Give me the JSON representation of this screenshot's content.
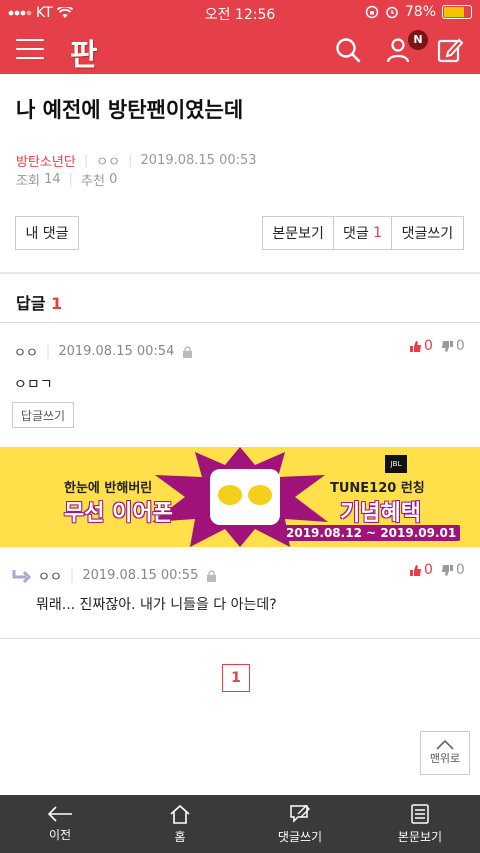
{
  "status_bar": {
    "carrier": "KT",
    "time": "오전 12:56",
    "battery": "78%",
    "battery_level": 0.78
  },
  "header": {
    "logo": "판",
    "notification_badge": "N"
  },
  "post": {
    "title": "나 예전에 방탄팬이였는데",
    "category": "방탄소년단",
    "author": "ㅇㅇ",
    "date": "2019.08.15 00:53",
    "views_label": "조회",
    "views": "14",
    "recommend_label": "추천",
    "recommend": "0"
  },
  "actions": {
    "my_comments": "내 댓글",
    "view_post": "본문보기",
    "comments_label": "댓글",
    "comments_count": "1",
    "write_comment": "댓글쓰기"
  },
  "replies": {
    "heading": "답글",
    "count": "1"
  },
  "comments": [
    {
      "author": "ㅇㅇ",
      "date": "2019.08.15 00:54",
      "likes": "0",
      "dislikes": "0",
      "text": "ㅇㅁㄱ",
      "reply_button": "답글쓰기"
    },
    {
      "author": "ㅇㅇ",
      "date": "2019.08.15 00:55",
      "likes": "0",
      "dislikes": "0",
      "text": "뭐래... 진짜잖아. 내가 니들을 다 아는데?"
    }
  ],
  "banner": {
    "line1": "한눈에 반해버린",
    "line2": "무선 이어폰",
    "line3": "TUNE120 런칭",
    "line4": "기념혜택",
    "dates": "2019.08.12 ~ 2019.09.01",
    "brand": "JBL"
  },
  "pagination": {
    "current": "1"
  },
  "to_top": "맨위로",
  "tabbar": {
    "back": "이전",
    "home": "홈",
    "write_comment": "댓글쓰기",
    "view_post": "본문보기"
  },
  "colors": {
    "brand": "#e5404a",
    "tabbar": "#3a3a3a",
    "banner": "#ffe04a"
  }
}
